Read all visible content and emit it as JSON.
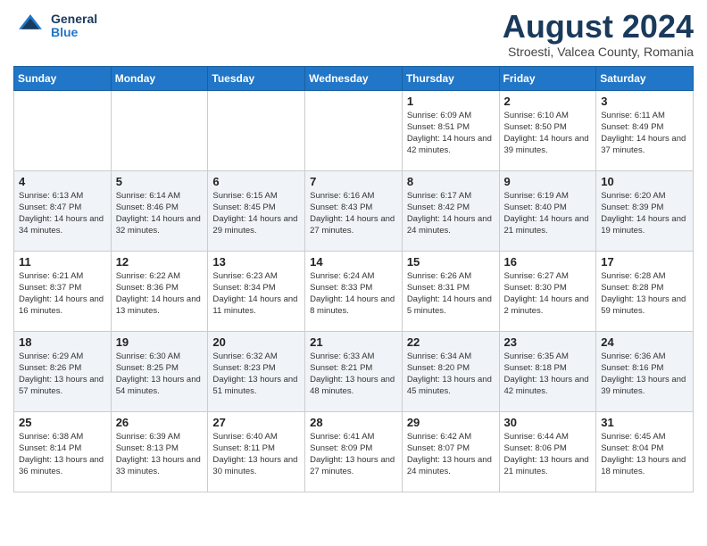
{
  "header": {
    "logo_general": "General",
    "logo_blue": "Blue",
    "month_year": "August 2024",
    "location": "Stroesti, Valcea County, Romania"
  },
  "weekdays": [
    "Sunday",
    "Monday",
    "Tuesday",
    "Wednesday",
    "Thursday",
    "Friday",
    "Saturday"
  ],
  "weeks": [
    [
      {
        "day": "",
        "info": ""
      },
      {
        "day": "",
        "info": ""
      },
      {
        "day": "",
        "info": ""
      },
      {
        "day": "",
        "info": ""
      },
      {
        "day": "1",
        "info": "Sunrise: 6:09 AM\nSunset: 8:51 PM\nDaylight: 14 hours\nand 42 minutes."
      },
      {
        "day": "2",
        "info": "Sunrise: 6:10 AM\nSunset: 8:50 PM\nDaylight: 14 hours\nand 39 minutes."
      },
      {
        "day": "3",
        "info": "Sunrise: 6:11 AM\nSunset: 8:49 PM\nDaylight: 14 hours\nand 37 minutes."
      }
    ],
    [
      {
        "day": "4",
        "info": "Sunrise: 6:13 AM\nSunset: 8:47 PM\nDaylight: 14 hours\nand 34 minutes."
      },
      {
        "day": "5",
        "info": "Sunrise: 6:14 AM\nSunset: 8:46 PM\nDaylight: 14 hours\nand 32 minutes."
      },
      {
        "day": "6",
        "info": "Sunrise: 6:15 AM\nSunset: 8:45 PM\nDaylight: 14 hours\nand 29 minutes."
      },
      {
        "day": "7",
        "info": "Sunrise: 6:16 AM\nSunset: 8:43 PM\nDaylight: 14 hours\nand 27 minutes."
      },
      {
        "day": "8",
        "info": "Sunrise: 6:17 AM\nSunset: 8:42 PM\nDaylight: 14 hours\nand 24 minutes."
      },
      {
        "day": "9",
        "info": "Sunrise: 6:19 AM\nSunset: 8:40 PM\nDaylight: 14 hours\nand 21 minutes."
      },
      {
        "day": "10",
        "info": "Sunrise: 6:20 AM\nSunset: 8:39 PM\nDaylight: 14 hours\nand 19 minutes."
      }
    ],
    [
      {
        "day": "11",
        "info": "Sunrise: 6:21 AM\nSunset: 8:37 PM\nDaylight: 14 hours\nand 16 minutes."
      },
      {
        "day": "12",
        "info": "Sunrise: 6:22 AM\nSunset: 8:36 PM\nDaylight: 14 hours\nand 13 minutes."
      },
      {
        "day": "13",
        "info": "Sunrise: 6:23 AM\nSunset: 8:34 PM\nDaylight: 14 hours\nand 11 minutes."
      },
      {
        "day": "14",
        "info": "Sunrise: 6:24 AM\nSunset: 8:33 PM\nDaylight: 14 hours\nand 8 minutes."
      },
      {
        "day": "15",
        "info": "Sunrise: 6:26 AM\nSunset: 8:31 PM\nDaylight: 14 hours\nand 5 minutes."
      },
      {
        "day": "16",
        "info": "Sunrise: 6:27 AM\nSunset: 8:30 PM\nDaylight: 14 hours\nand 2 minutes."
      },
      {
        "day": "17",
        "info": "Sunrise: 6:28 AM\nSunset: 8:28 PM\nDaylight: 13 hours\nand 59 minutes."
      }
    ],
    [
      {
        "day": "18",
        "info": "Sunrise: 6:29 AM\nSunset: 8:26 PM\nDaylight: 13 hours\nand 57 minutes."
      },
      {
        "day": "19",
        "info": "Sunrise: 6:30 AM\nSunset: 8:25 PM\nDaylight: 13 hours\nand 54 minutes."
      },
      {
        "day": "20",
        "info": "Sunrise: 6:32 AM\nSunset: 8:23 PM\nDaylight: 13 hours\nand 51 minutes."
      },
      {
        "day": "21",
        "info": "Sunrise: 6:33 AM\nSunset: 8:21 PM\nDaylight: 13 hours\nand 48 minutes."
      },
      {
        "day": "22",
        "info": "Sunrise: 6:34 AM\nSunset: 8:20 PM\nDaylight: 13 hours\nand 45 minutes."
      },
      {
        "day": "23",
        "info": "Sunrise: 6:35 AM\nSunset: 8:18 PM\nDaylight: 13 hours\nand 42 minutes."
      },
      {
        "day": "24",
        "info": "Sunrise: 6:36 AM\nSunset: 8:16 PM\nDaylight: 13 hours\nand 39 minutes."
      }
    ],
    [
      {
        "day": "25",
        "info": "Sunrise: 6:38 AM\nSunset: 8:14 PM\nDaylight: 13 hours\nand 36 minutes."
      },
      {
        "day": "26",
        "info": "Sunrise: 6:39 AM\nSunset: 8:13 PM\nDaylight: 13 hours\nand 33 minutes."
      },
      {
        "day": "27",
        "info": "Sunrise: 6:40 AM\nSunset: 8:11 PM\nDaylight: 13 hours\nand 30 minutes."
      },
      {
        "day": "28",
        "info": "Sunrise: 6:41 AM\nSunset: 8:09 PM\nDaylight: 13 hours\nand 27 minutes."
      },
      {
        "day": "29",
        "info": "Sunrise: 6:42 AM\nSunset: 8:07 PM\nDaylight: 13 hours\nand 24 minutes."
      },
      {
        "day": "30",
        "info": "Sunrise: 6:44 AM\nSunset: 8:06 PM\nDaylight: 13 hours\nand 21 minutes."
      },
      {
        "day": "31",
        "info": "Sunrise: 6:45 AM\nSunset: 8:04 PM\nDaylight: 13 hours\nand 18 minutes."
      }
    ]
  ]
}
